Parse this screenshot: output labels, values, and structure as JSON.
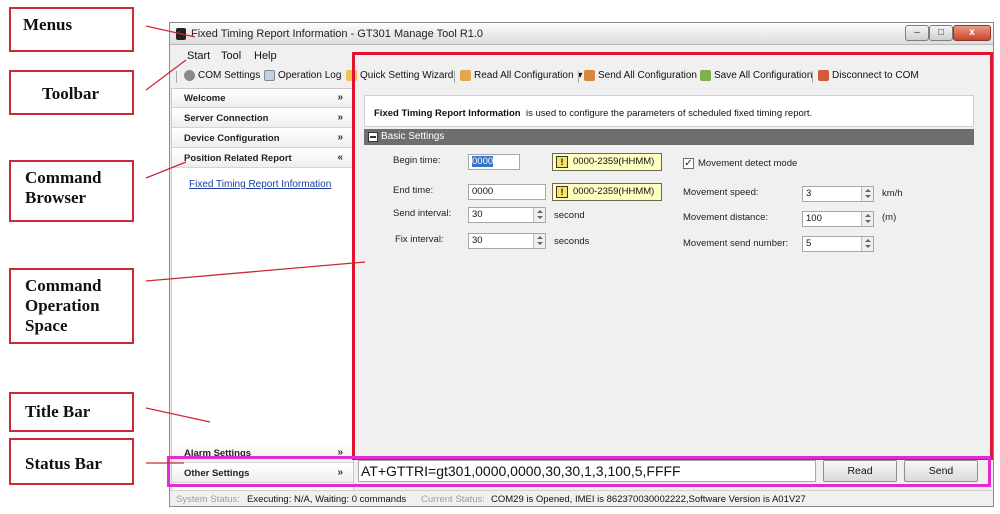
{
  "callouts": {
    "menus": "Menus",
    "toolbar": "Toolbar",
    "command_browser": "Command Browser",
    "command_operation_space": "Command Operation Space",
    "title_bar": "Title Bar",
    "status_bar": "Status Bar"
  },
  "colors": {
    "callout_border": "#cc2a36",
    "highlight_red": "#e0142f",
    "highlight_magenta": "#e42ad0"
  },
  "window": {
    "title": "Fixed Timing Report Information - GT301 Manage Tool R1.0",
    "controls": {
      "minimize": "–",
      "maximize": "□",
      "close": "x"
    }
  },
  "menu": [
    "Start",
    "Tool",
    "Help"
  ],
  "toolbar": [
    {
      "label": "COM Settings",
      "icon": "gear-icon"
    },
    {
      "label": "Operation Log",
      "icon": "log-icon"
    },
    {
      "label": "Quick Setting Wizard",
      "icon": "wizard-icon"
    },
    {
      "label": "Read All Configuration",
      "icon": "read-icon"
    },
    {
      "label": "Send All Configuration",
      "icon": "send-icon"
    },
    {
      "label": "Save All Configuration",
      "icon": "save-icon"
    },
    {
      "label": "Disconnect to COM",
      "icon": "disconnect-icon"
    }
  ],
  "toolbar_dropdown_glyph": "▾",
  "nav": {
    "sections": [
      {
        "label": "Welcome",
        "chev": "»"
      },
      {
        "label": "Server Connection",
        "chev": "»"
      },
      {
        "label": "Device Configuration",
        "chev": "»"
      },
      {
        "label": "Position Related Report",
        "chev": "«"
      }
    ],
    "bottom_sections": [
      {
        "label": "Alarm Settings",
        "chev": "»"
      },
      {
        "label": "Other Settings",
        "chev": "»"
      }
    ],
    "active_link": "Fixed Timing Report Information"
  },
  "content": {
    "info_title": "Fixed Timing Report Information",
    "info_desc": "is used to configure the parameters of scheduled fixed timing report.",
    "section_title": "Basic Settings",
    "fields": {
      "begin_time": {
        "label": "Begin time:",
        "value": "0000",
        "hint": "0000-2359(HHMM)"
      },
      "end_time": {
        "label": "End time:",
        "value": "0000",
        "hint": "0000-2359(HHMM)"
      },
      "send_interval": {
        "label": "Send interval:",
        "value": "30",
        "unit": "second"
      },
      "fix_interval": {
        "label": "Fix interval:",
        "value": "30",
        "unit": "seconds"
      },
      "movement_detect": {
        "label": "Movement detect mode",
        "checked": "✓"
      },
      "movement_speed": {
        "label": "Movement speed:",
        "value": "3",
        "unit": "km/h"
      },
      "movement_distance": {
        "label": "Movement distance:",
        "value": "100",
        "unit": "(m)"
      },
      "movement_send_number": {
        "label": "Movement send number:",
        "value": "5"
      }
    }
  },
  "command": {
    "text": "AT+GTTRI=gt301,0000,0000,30,30,1,3,100,5,FFFF",
    "read_label": "Read",
    "send_label": "Send"
  },
  "status": {
    "system_label": "System Status:",
    "system_value": "Executing: N/A, Waiting: 0 commands",
    "current_label": "Current Status:",
    "current_value": "COM29 is Opened, IMEI is 862370030002222,Software Version is A01V27"
  }
}
